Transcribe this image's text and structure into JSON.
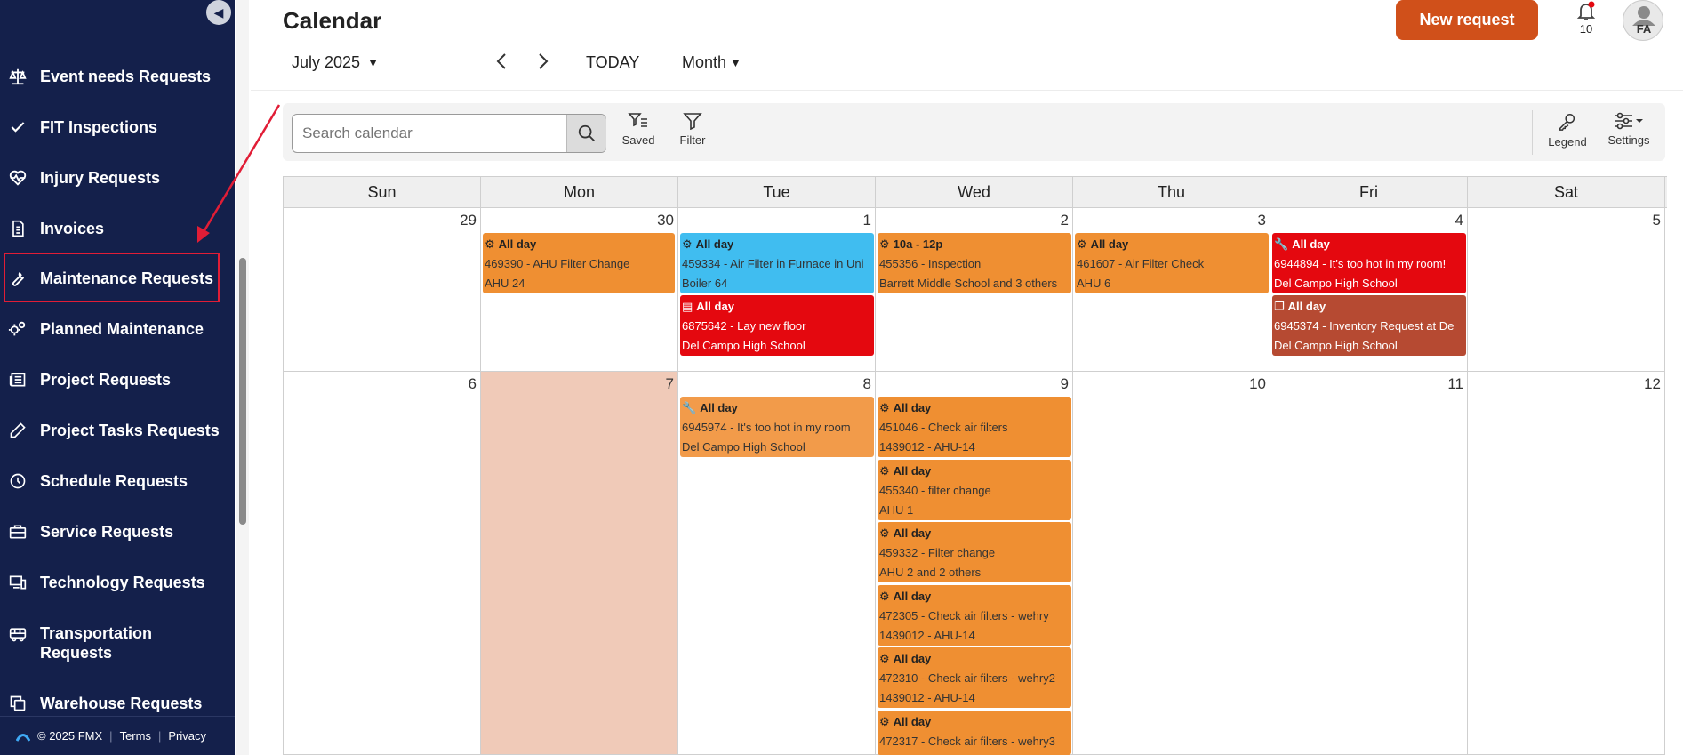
{
  "sidebar": {
    "collapse_icon": "chevron-left-icon",
    "items": [
      {
        "label": "Event needs Requests",
        "icon": "scale-icon"
      },
      {
        "label": "FIT Inspections",
        "icon": "check-icon"
      },
      {
        "label": "Injury Requests",
        "icon": "heart-pulse-icon"
      },
      {
        "label": "Invoices",
        "icon": "invoice-icon"
      },
      {
        "label": "Maintenance Requests",
        "icon": "wrench-icon"
      },
      {
        "label": "Planned Maintenance",
        "icon": "gears-icon"
      },
      {
        "label": "Project Requests",
        "icon": "newspaper-icon"
      },
      {
        "label": "Project Tasks Requests",
        "icon": "pencil-icon"
      },
      {
        "label": "Schedule Requests",
        "icon": "clock-icon"
      },
      {
        "label": "Service Requests",
        "icon": "briefcase-icon"
      },
      {
        "label": "Technology Requests",
        "icon": "devices-icon"
      },
      {
        "label": "Transportation Requests",
        "icon": "bus-icon"
      },
      {
        "label": "Warehouse Requests",
        "icon": "copy-icon"
      }
    ],
    "footer": {
      "copyright": "© 2025 FMX",
      "terms": "Terms",
      "privacy": "Privacy"
    }
  },
  "header": {
    "title": "Calendar",
    "new_request": "New request",
    "notification_count": "10",
    "avatar_initials": "FA",
    "month_label": "July 2025",
    "today": "TODAY",
    "view_label": "Month"
  },
  "toolbar": {
    "search_placeholder": "Search calendar",
    "saved": "Saved",
    "filter": "Filter",
    "legend": "Legend",
    "settings": "Settings"
  },
  "calendar": {
    "weekdays": [
      "Sun",
      "Mon",
      "Tue",
      "Wed",
      "Thu",
      "Fri",
      "Sat"
    ],
    "weeks": [
      [
        "29",
        "30",
        "1",
        "2",
        "3",
        "4",
        "5"
      ],
      [
        "6",
        "7",
        "8",
        "9",
        "10",
        "11",
        "12"
      ]
    ],
    "events": [
      {
        "id": "ev-469390",
        "time": "All day",
        "title": "469390 - AHU Filter Change",
        "location": "AHU 24",
        "icon": "gears-icon",
        "color": "orange"
      },
      {
        "id": "ev-459334",
        "time": "All day",
        "title": "459334 - Air Filter in Furnace in Uni",
        "location": "Boiler 64",
        "icon": "gears-icon",
        "color": "blue"
      },
      {
        "id": "ev-6875642",
        "time": "All day",
        "title": "6875642 - Lay new floor",
        "location": "Del Campo High School",
        "icon": "newspaper-icon",
        "color": "red"
      },
      {
        "id": "ev-455356",
        "time": "10a - 12p",
        "title": "455356 - Inspection",
        "location": "Barrett Middle School and 3 others",
        "icon": "gears-icon",
        "color": "orange"
      },
      {
        "id": "ev-461607",
        "time": "All day",
        "title": "461607 - Air Filter Check",
        "location": "AHU 6",
        "icon": "gears-icon",
        "color": "orange"
      },
      {
        "id": "ev-6944894",
        "time": "All day",
        "title": "6944894 - It's too hot in my room!",
        "location": "Del Campo High School",
        "icon": "wrench-icon",
        "color": "red"
      },
      {
        "id": "ev-6945374",
        "time": "All day",
        "title": "6945374 - Inventory Request at De",
        "location": "Del Campo High School",
        "icon": "copy-icon",
        "color": "brown"
      },
      {
        "id": "ev-6945974",
        "time": "All day",
        "title": "6945974 - It's too hot in my room",
        "location": "Del Campo High School",
        "icon": "wrench-icon",
        "color": "orange-light"
      },
      {
        "id": "ev-451046",
        "time": "All day",
        "title": "451046 - Check air filters",
        "location": "1439012 - AHU-14",
        "icon": "gears-icon",
        "color": "orange"
      },
      {
        "id": "ev-455340",
        "time": "All day",
        "title": "455340 - filter change",
        "location": "AHU 1",
        "icon": "gears-icon",
        "color": "orange"
      },
      {
        "id": "ev-459332",
        "time": "All day",
        "title": "459332 - Filter change",
        "location": "AHU 2 and 2 others",
        "icon": "gears-icon",
        "color": "orange"
      },
      {
        "id": "ev-472305",
        "time": "All day",
        "title": "472305 - Check air filters - wehry",
        "location": "1439012 - AHU-14",
        "icon": "gears-icon",
        "color": "orange"
      },
      {
        "id": "ev-472310",
        "time": "All day",
        "title": "472310 - Check air filters - wehry2",
        "location": "1439012 - AHU-14",
        "icon": "gears-icon",
        "color": "orange"
      },
      {
        "id": "ev-472317",
        "time": "All day",
        "title": "472317 - Check air filters - wehry3",
        "location": "",
        "icon": "gears-icon",
        "color": "orange"
      }
    ]
  },
  "colors": {
    "sidebar_bg": "#14204b",
    "accent": "#d0501a",
    "highlight": "#e11d36",
    "today_bg": "#f0cab8",
    "event_orange": "#ef8f32",
    "event_blue": "#40bdf0",
    "event_red": "#e4080f",
    "event_brown": "#b64a32"
  }
}
